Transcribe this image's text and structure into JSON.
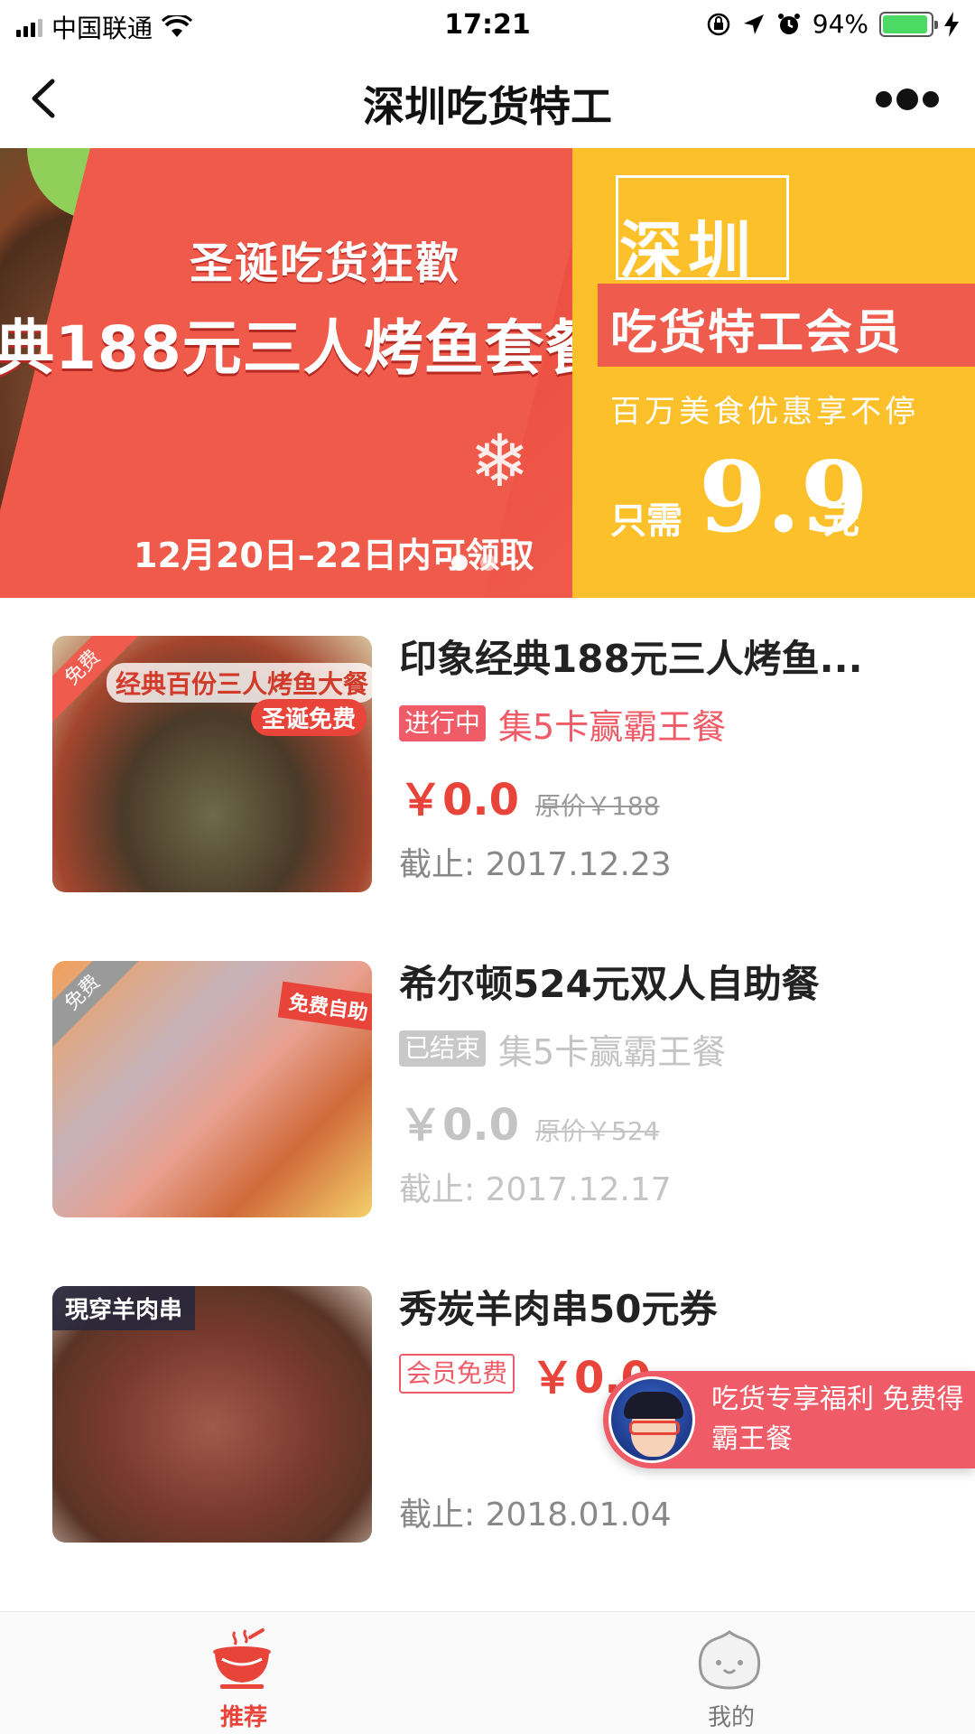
{
  "status_bar": {
    "carrier": "中国联通",
    "time": "17:21",
    "battery": "94%",
    "battery_level": 0.94,
    "icons": [
      "signal-icon",
      "wifi-icon",
      "orientation-lock-icon",
      "location-arrow-icon",
      "alarm-icon",
      "battery-icon",
      "charging-bolt-icon"
    ]
  },
  "nav": {
    "title": "深圳吃货特工",
    "back_icon": "chevron-left-icon",
    "more_icon": "more-dots-icon"
  },
  "banner": {
    "left": {
      "subtitle": "圣诞吃货狂歡",
      "headline": "典188元三人烤鱼套餐",
      "date_text": "12月20日–22日内可领取"
    },
    "right": {
      "city": "深圳",
      "member_title": "吃货特工会员",
      "slogan": "百万美食优惠享不停",
      "price_prefix": "只需",
      "price": "9.9",
      "price_suffix": "元"
    },
    "page_count": 2,
    "active_page": 1
  },
  "items": [
    {
      "name": "印象经典188元三人烤鱼...",
      "corner": "免费",
      "thumb_text_1": "经典百份三人烤鱼大餐",
      "thumb_text_2": "圣诞免费",
      "status_tag": "进行中",
      "campaign": "集5卡赢霸王餐",
      "price": "￥0.0",
      "original_price": "原价￥188",
      "deadline": "截止: 2017.12.23"
    },
    {
      "name": "希尔顿524元双人自助餐",
      "corner": "免费",
      "thumb_text_1": "免费自助",
      "status_tag": "已结束",
      "campaign": "集5卡赢霸王餐",
      "price": "￥0.0",
      "original_price": "原价￥524",
      "deadline": "截止: 2017.12.17"
    },
    {
      "name": "秀炭羊肉串50元券",
      "thumb_text_1": "現穿羊肉串",
      "status_tag": "会员免费",
      "price": "￥0.0",
      "deadline": "截止: 2018.01.04"
    }
  ],
  "promo": {
    "text": "吃货专享福利 免费得霸王餐"
  },
  "tabbar": {
    "tabs": [
      {
        "label": "推荐",
        "icon": "hotpot-icon",
        "active": true
      },
      {
        "label": "我的",
        "icon": "bun-face-icon",
        "active": false
      }
    ],
    "accent_color": "#e8443a"
  }
}
